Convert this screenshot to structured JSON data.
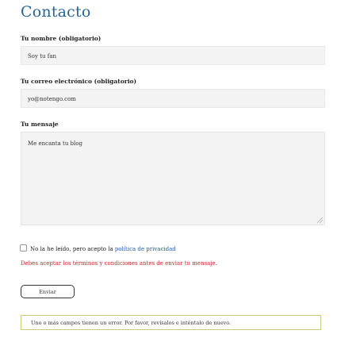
{
  "page": {
    "title": "Contacto"
  },
  "form": {
    "name_label": "Tu nombre (obligatorio)",
    "name_value": "Soy tu fan",
    "email_label": "Tu correo electrónico (obligatorio)",
    "email_value": "yo@notengo.com",
    "message_label": "Tu mensaje",
    "message_value": "Me encanta tu blog",
    "consent_text": "No la he leído, pero acepto la ",
    "consent_link": "política de privacidad",
    "consent_checked": false,
    "consent_error": "Debes aceptar los términos y condiciones antes de enviar tu mensaje.",
    "submit_label": "Enviar",
    "form_error": "Uno o más campos tienen un error. Por favor, revísalos e inténtalo de nuevo."
  },
  "colors": {
    "title": "#2a6496",
    "link": "#1f5fa6",
    "error_text": "#c0282a",
    "error_box_border": "#c9c97a",
    "field_bg": "#f3f3f3"
  }
}
